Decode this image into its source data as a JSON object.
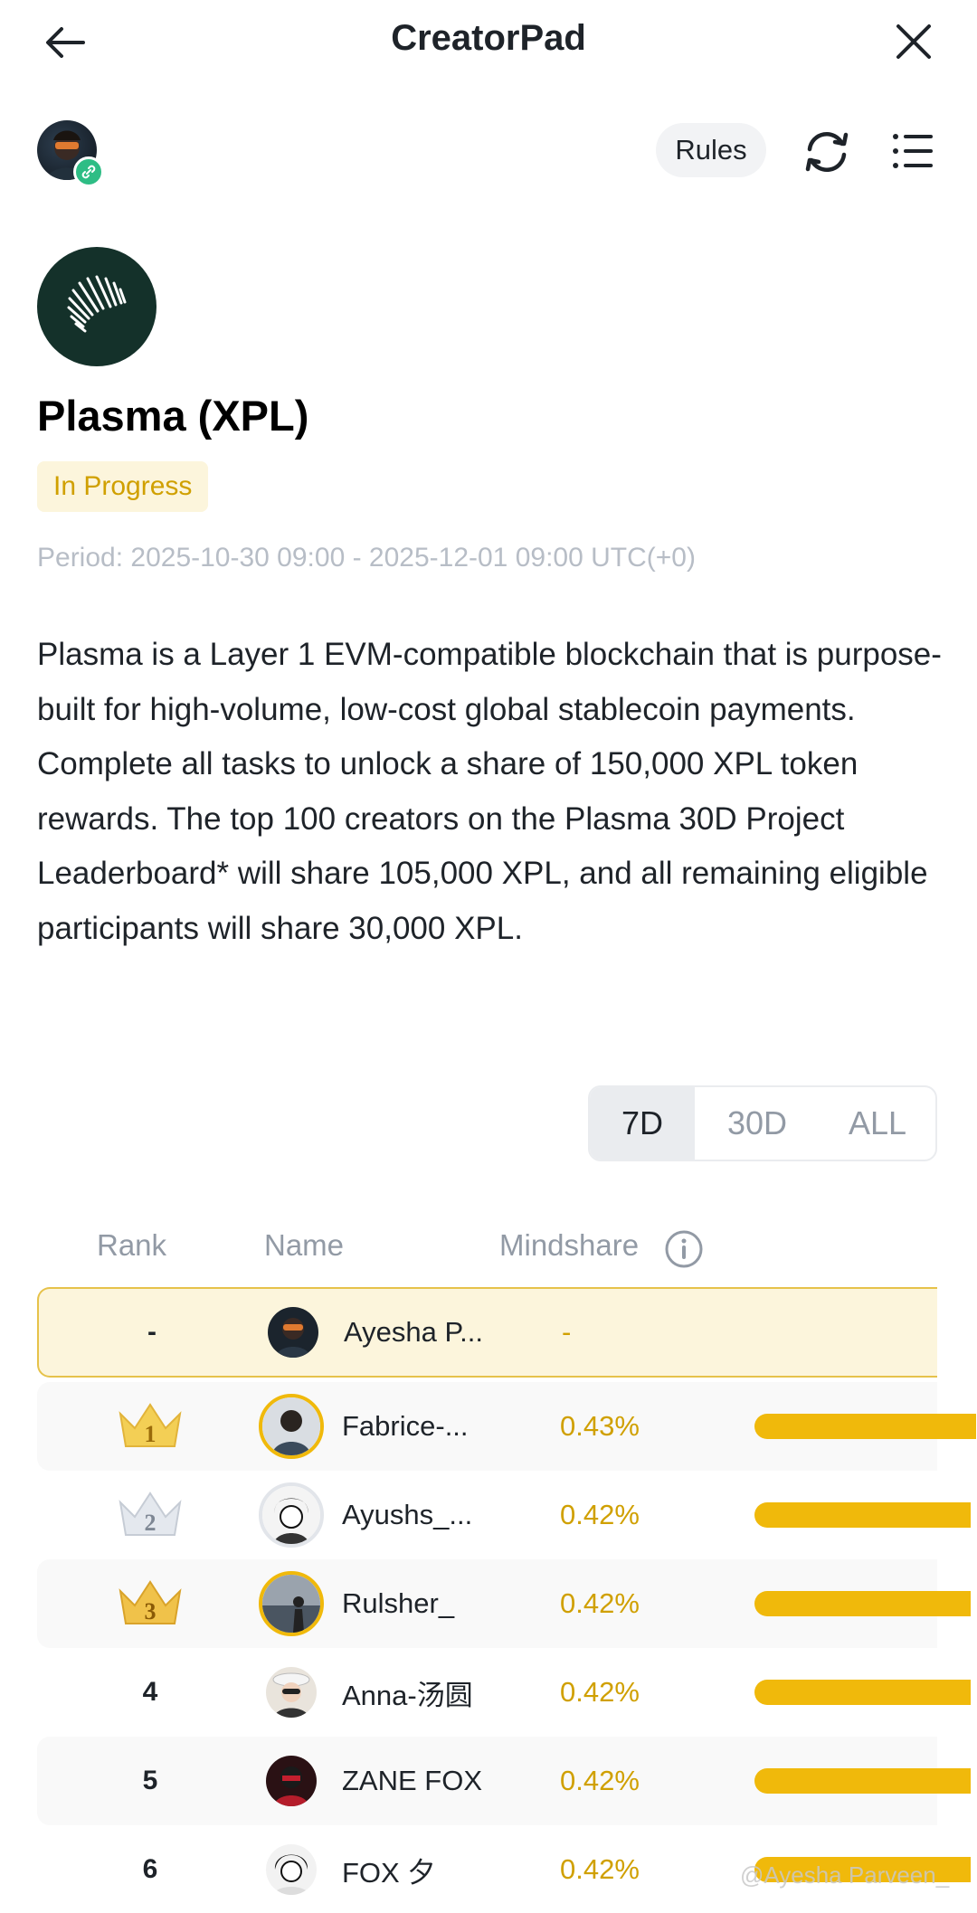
{
  "header": {
    "title": "CreatorPad"
  },
  "toolbar": {
    "rules_label": "Rules"
  },
  "project": {
    "name": "Plasma (XPL)",
    "status": "In Progress",
    "period": "Period: 2025-10-30 09:00 - 2025-12-01 09:00 UTC(+0)",
    "description": "Plasma is a Layer 1 EVM-compatible blockchain that is purpose-built for high-volume, low-cost global stablecoin payments. Complete all tasks to unlock a share of 150,000 XPL token rewards. The top 100 creators on the Plasma 30D Project Leaderboard* will share 105,000 XPL, and all remaining eligible participants will share 30,000 XPL."
  },
  "range_tabs": [
    {
      "label": "7D",
      "active": true
    },
    {
      "label": "30D",
      "active": false
    },
    {
      "label": "ALL",
      "active": false
    }
  ],
  "leaderboard": {
    "columns": {
      "rank": "Rank",
      "name": "Name",
      "mindshare": "Mindshare"
    },
    "me": {
      "rank": "-",
      "name": "Ayesha P...",
      "mindshare": "-"
    },
    "rows": [
      {
        "rank": "1",
        "name": "Fabrice-...",
        "mindshare": "0.43%",
        "share": 0.43
      },
      {
        "rank": "2",
        "name": "Ayushs_...",
        "mindshare": "0.42%",
        "share": 0.42
      },
      {
        "rank": "3",
        "name": "Rulsher_",
        "mindshare": "0.42%",
        "share": 0.42
      },
      {
        "rank": "4",
        "name": "Anna-汤圆",
        "mindshare": "0.42%",
        "share": 0.42
      },
      {
        "rank": "5",
        "name": "ZANE FOX",
        "mindshare": "0.42%",
        "share": 0.42
      },
      {
        "rank": "6",
        "name": "FOX 夕",
        "mindshare": "0.42%",
        "share": 0.42
      }
    ]
  },
  "watermark": "@Ayesha Parveen_",
  "icons": {
    "back": "arrow-left-icon",
    "close": "close-icon",
    "refresh": "refresh-icon",
    "menu": "list-menu-icon",
    "info": "info-icon",
    "link": "link-icon"
  },
  "colors": {
    "accent": "#f0b90b",
    "accent_text": "#d0a000",
    "badge_bg": "#fcf5dc",
    "link_green": "#2ebd85"
  }
}
